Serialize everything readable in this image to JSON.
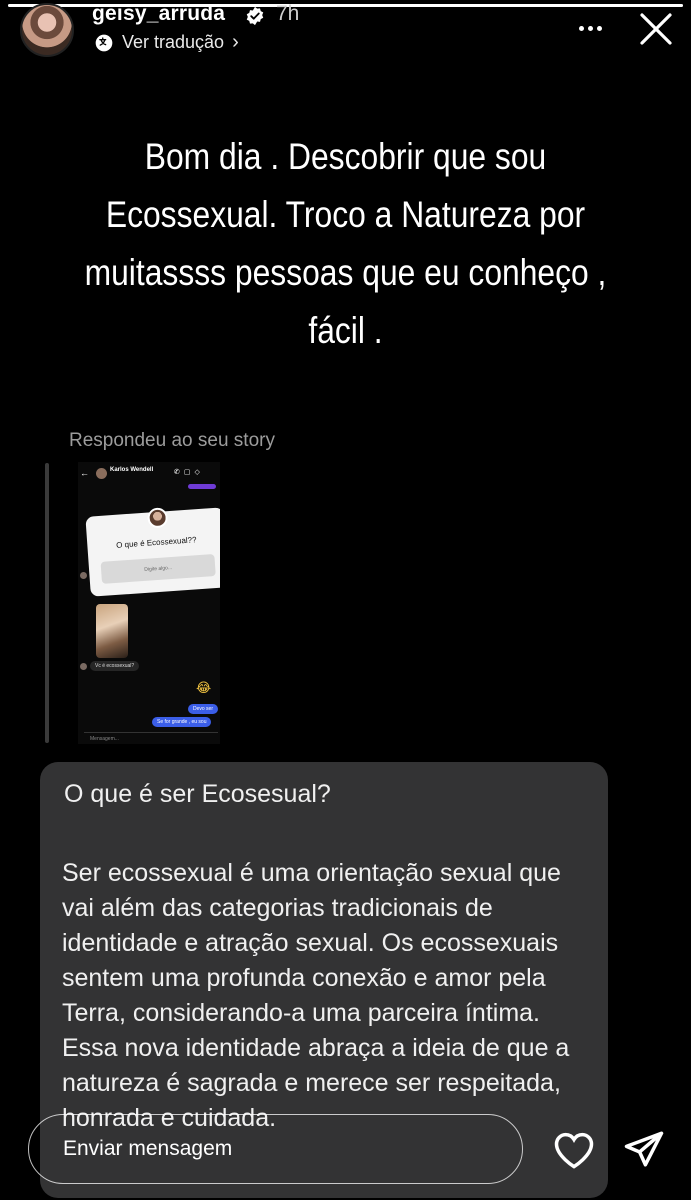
{
  "header": {
    "username": "geisy_arruda",
    "time": "7h",
    "translate_label": "Ver tradução",
    "progress_fraction": 1.0
  },
  "story": {
    "lines": [
      "Bom dia . Descobrir que sou",
      "Ecossexual. Troco a Natureza por",
      "muitassss pessoas que eu conheço ,",
      "fácil ."
    ],
    "replied_label": "Respondeu ao seu story"
  },
  "embedded_screenshot": {
    "contact_name": "Karlos Wendell",
    "question_sticker": "O que é Ecossexual??",
    "sticker_placeholder": "Digite algo...",
    "received_message": "Vc é ecossexual?",
    "emoji": "😂",
    "sent_messages": [
      "Devo ser",
      "Se for grande , eu sou"
    ],
    "input_placeholder": "Mensagem..."
  },
  "info_card": {
    "title": "O que é ser Ecosesual?",
    "body": "Ser ecossexual é uma orientação sexual que vai além das categorias tradicionais de identidade e atração sexual. Os ecossexuais sentem uma profunda conexão e amor pela Terra, considerando-a uma parceira íntima. Essa nova identidade abraça a ideia de que a natureza é sagrada e merece ser respeitada, honrada e cuidada."
  },
  "footer": {
    "message_placeholder": "Enviar mensagem",
    "like_icon": "heart-icon",
    "send_icon": "send-icon"
  }
}
